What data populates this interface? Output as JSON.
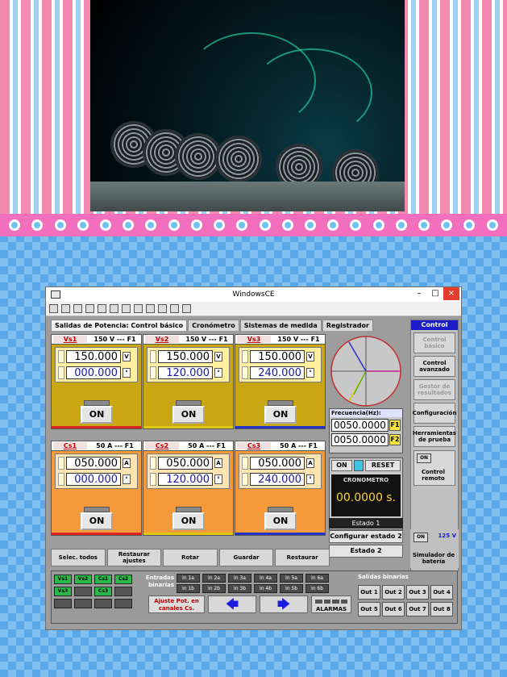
{
  "window": {
    "title": "WindowsCE"
  },
  "tabs": [
    "Salidas de Potencia: Control básico",
    "Cronómetro",
    "Sistemas de medida",
    "Registrador"
  ],
  "voltage_panels": [
    {
      "label": "Vs1",
      "range": "150 V --- F1",
      "value": "150.000",
      "unit": "V",
      "angle": "000.000",
      "angle_unit": "°",
      "button": "ON"
    },
    {
      "label": "Vs2",
      "range": "150 V --- F1",
      "value": "150.000",
      "unit": "V",
      "angle": "120.000",
      "angle_unit": "°",
      "button": "ON"
    },
    {
      "label": "Vs3",
      "range": "150 V --- F1",
      "value": "150.000",
      "unit": "V",
      "angle": "240.000",
      "angle_unit": "°",
      "button": "ON"
    }
  ],
  "current_panels": [
    {
      "label": "Cs1",
      "range": "50 A --- F1",
      "value": "050.000",
      "unit": "A",
      "angle": "000.000",
      "angle_unit": "°",
      "button": "ON"
    },
    {
      "label": "Cs2",
      "range": "50 A --- F1",
      "value": "050.000",
      "unit": "A",
      "angle": "120.000",
      "angle_unit": "°",
      "button": "ON"
    },
    {
      "label": "Cs3",
      "range": "50 A --- F1",
      "value": "050.000",
      "unit": "A",
      "angle": "240.000",
      "angle_unit": "°",
      "button": "ON"
    }
  ],
  "frequency": {
    "label": "Frecuencia(Hz):",
    "f1": "0050.0000",
    "f1_tag": "F1",
    "f2": "0050.0000",
    "f2_tag": "F2"
  },
  "chrono": {
    "on": "ON",
    "reset": "RESET",
    "title": "CRONOMETRO",
    "value": "00.0000 s."
  },
  "estado": {
    "current": "Estado 1",
    "configure": "Configurar estado 2",
    "next": "Estado 2"
  },
  "sidebar": {
    "header": "Control",
    "items": [
      "Control básico",
      "Control avanzado",
      "Gestor de resultados",
      "Configuración",
      "Herramientas de prueba"
    ],
    "remote_on": "ON",
    "remote_label": "Control remoto",
    "battery_on": "ON",
    "battery_voltage": "125 V",
    "battery_label": "Simulador de batería"
  },
  "actions": [
    "Selec. todos",
    "Restaurar ajustes",
    "Rotar",
    "Guardar",
    "Restaurar"
  ],
  "leds": [
    "Vs1",
    "Vs2",
    "Cs1",
    "Cs2",
    "Vs3",
    "",
    "Cs3",
    "",
    "",
    "",
    "",
    ""
  ],
  "binary_inputs": {
    "label": "Entradas binarias",
    "items": [
      "In 1a",
      "In 2a",
      "In 3a",
      "In 4a",
      "In 5a",
      "In 6a",
      "In 1b",
      "In 2b",
      "In 3b",
      "In 4b",
      "In 5b",
      "In 6b"
    ]
  },
  "ajuste": "Ajuste Pot. en canales Cs.",
  "arrows": {
    "left": "🡄",
    "right": "🡆"
  },
  "alarm": "ALARMAS",
  "binary_outputs": {
    "label": "Salidas binarias",
    "items": [
      "Out 1",
      "Out 2",
      "Out 3",
      "Out 4",
      "Out 5",
      "Out 6",
      "Out 7",
      "Out 8"
    ]
  },
  "colors": {
    "voltage_panel": "#c8a712",
    "current_panel": "#f59a3a",
    "phase1": "#d22",
    "phase2": "#e0c800",
    "phase3": "#2233cc"
  }
}
